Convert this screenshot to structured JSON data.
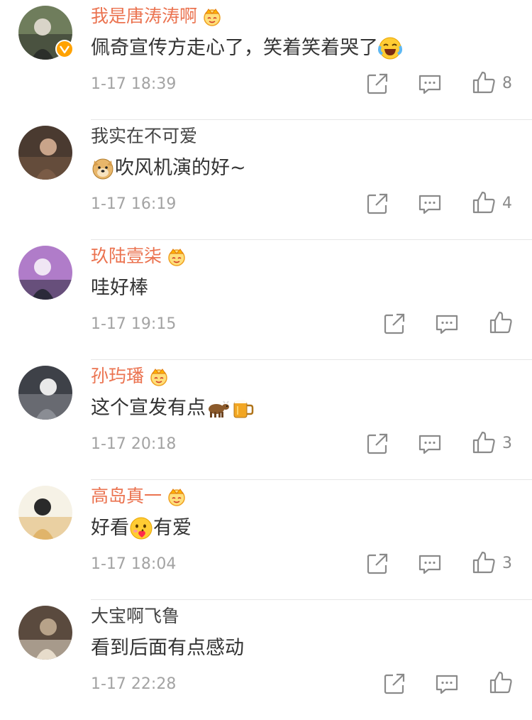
{
  "comments": [
    {
      "username": "我是唐涛涛啊",
      "member": true,
      "verified": true,
      "text_before": "佩奇宣传方走心了，笑着笑着哭了",
      "emoji_after": "laughing-crying",
      "time": "1-17 18:39",
      "likes": "8",
      "avatar_colors": [
        "#6f7d5c",
        "#d9d4c8",
        "#2b2f2a"
      ]
    },
    {
      "username": "我实在不可爱",
      "member": false,
      "verified": false,
      "emoji_before": "doge",
      "text_after": "吹风机演的好~",
      "time": "1-17 16:19",
      "likes": "4",
      "avatar_colors": [
        "#4a3a30",
        "#c9a48a",
        "#7a5b46"
      ]
    },
    {
      "username": "玖陆壹柒",
      "member": true,
      "verified": false,
      "text_before": "哇好棒",
      "time": "1-17 19:15",
      "likes": "",
      "avatar_colors": [
        "#b07cc9",
        "#f0e6f4",
        "#2b2a3a"
      ]
    },
    {
      "username": "孙玙璠",
      "member": true,
      "verified": false,
      "text_before": "这个宣发有点",
      "emoji_after": "cow",
      "emoji_after2": "beer",
      "time": "1-17 20:18",
      "likes": "3",
      "avatar_colors": [
        "#3e4148",
        "#e9e9e9",
        "#8a8d94"
      ]
    },
    {
      "username": "高岛真一",
      "member": true,
      "verified": false,
      "text_before": "好看",
      "emoji_after": "love-face",
      "text_after": "有爱",
      "time": "1-17 18:04",
      "likes": "3",
      "avatar_colors": [
        "#f6f2e6",
        "#2a2a2a",
        "#e0b46a"
      ]
    },
    {
      "username": "大宝啊飞鲁",
      "member": false,
      "verified": false,
      "text_before": "看到后面有点感动",
      "time": "1-17 22:28",
      "likes": "",
      "avatar_colors": [
        "#5a4a3e",
        "#b7a289",
        "#e7dccb"
      ]
    }
  ],
  "colors": {
    "member_name": "#eb7350",
    "normal_name": "#444444",
    "text": "#333333",
    "meta": "#a3a3a3",
    "icon": "#8a8a8a",
    "divider": "#e6e6e6"
  }
}
